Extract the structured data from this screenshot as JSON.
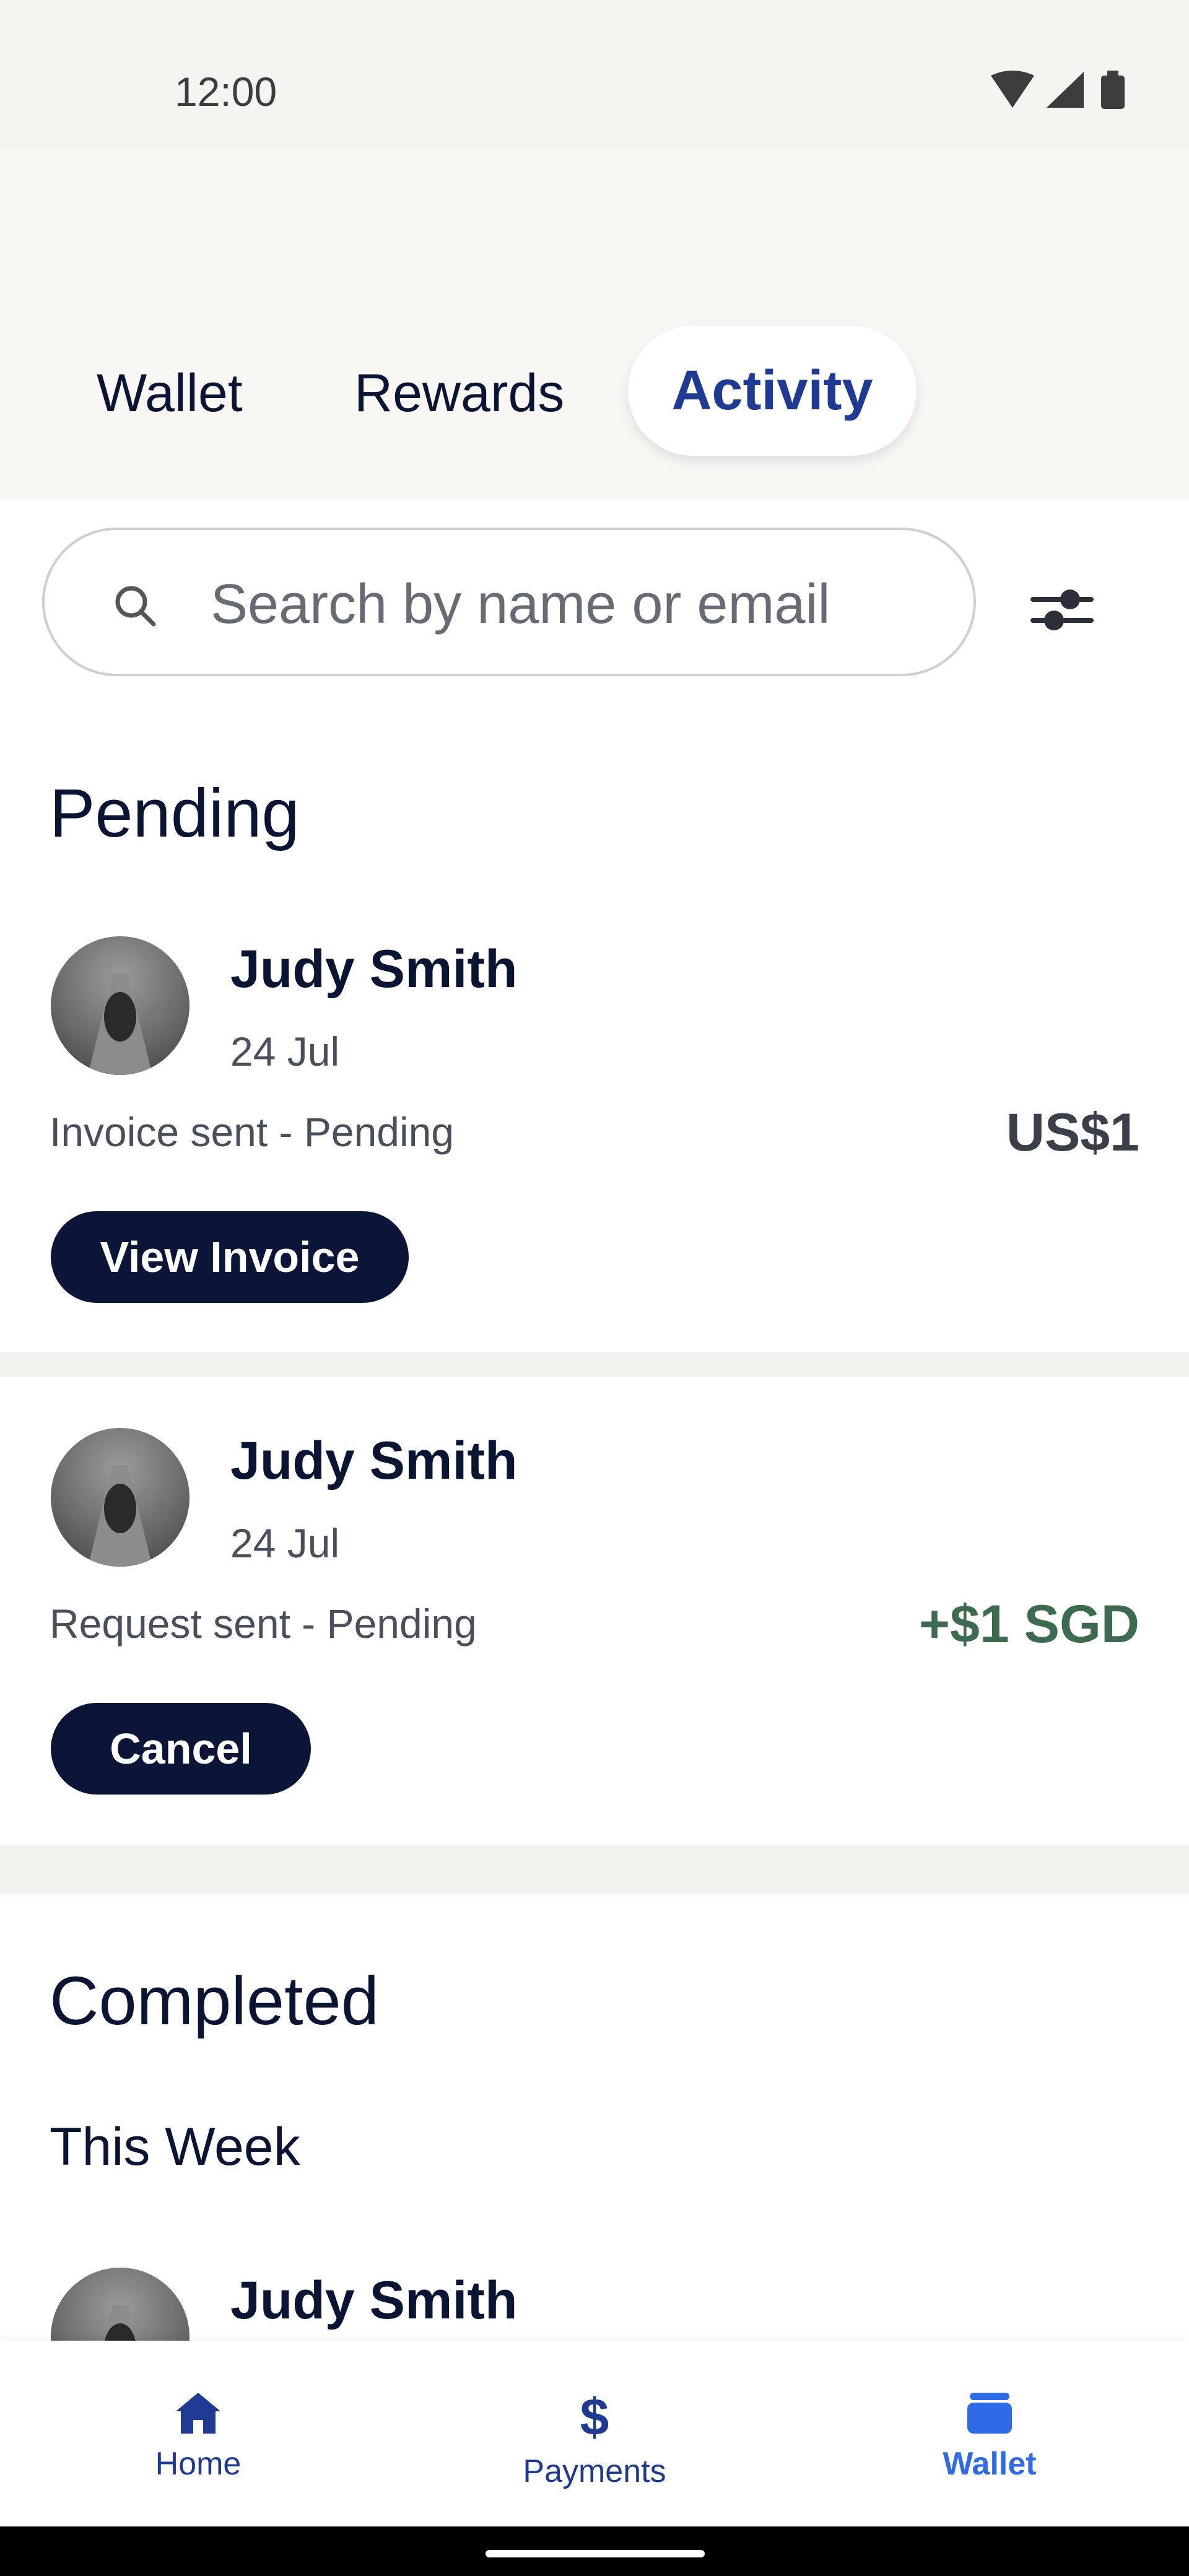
{
  "status_bar": {
    "time": "12:00"
  },
  "tabs": [
    {
      "label": "Wallet",
      "active": false
    },
    {
      "label": "Rewards",
      "active": false
    },
    {
      "label": "Activity",
      "active": true
    }
  ],
  "search": {
    "placeholder": "Search by name or email",
    "value": ""
  },
  "pending": {
    "heading": "Pending",
    "items": [
      {
        "name": "Judy Smith",
        "date": "24 Jul",
        "description": "Invoice sent - Pending",
        "amount": "US$1",
        "action": "View Invoice"
      },
      {
        "name": "Judy Smith",
        "date": "24 Jul",
        "description": "Request sent - Pending",
        "amount": "+$1 SGD",
        "action": "Cancel"
      }
    ]
  },
  "completed": {
    "heading": "Completed",
    "subheading": "This Week",
    "items": [
      {
        "name": "Judy Smith"
      }
    ]
  },
  "bottom_nav": [
    {
      "label": "Home",
      "icon": "home-icon",
      "active": false
    },
    {
      "label": "Payments",
      "icon": "dollar-icon",
      "active": false
    },
    {
      "label": "Wallet",
      "icon": "wallet-icon",
      "active": true
    }
  ],
  "colors": {
    "brand": "#1f3a93",
    "active_nav": "#2f6be6",
    "button_bg": "#0b1538",
    "positive_amount": "#3d6b4f",
    "background": "#f8f7f4"
  }
}
